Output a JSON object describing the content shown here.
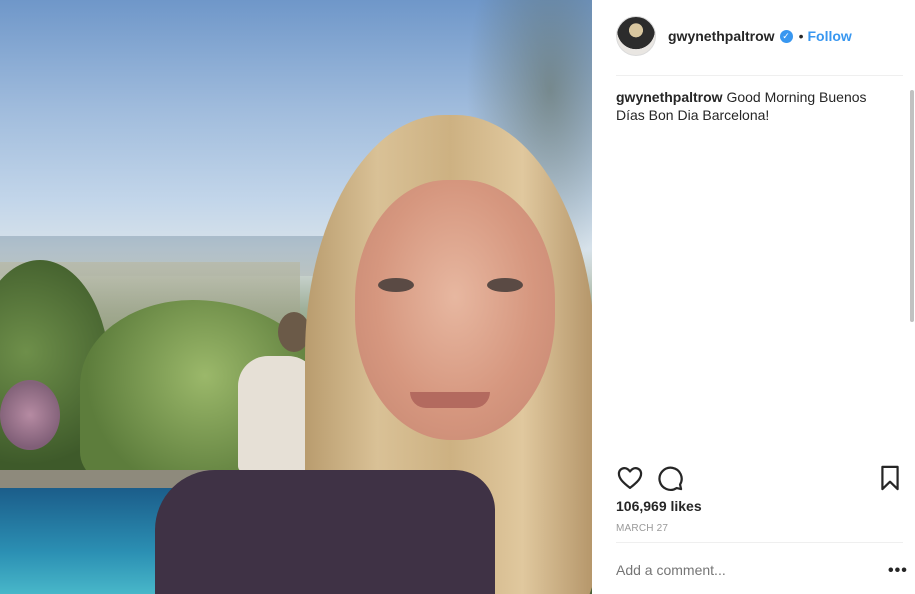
{
  "post": {
    "username": "gwynethpaltrow",
    "verified_icon": "verified-badge-icon",
    "separator": "•",
    "follow_label": "Follow",
    "caption_user": "gwynethpaltrow",
    "caption_text": "Good Morning Buenos Días Bon Dia Barcelona!",
    "likes": "106,969 likes",
    "date": "MARCH 27",
    "comment_placeholder": "Add a comment...",
    "more_label": "•••"
  },
  "icons": {
    "like": "heart-icon",
    "comment": "comment-bubble-icon",
    "save": "bookmark-icon"
  },
  "colors": {
    "accent": "#3897f0",
    "text": "#262626",
    "muted": "#999999"
  }
}
